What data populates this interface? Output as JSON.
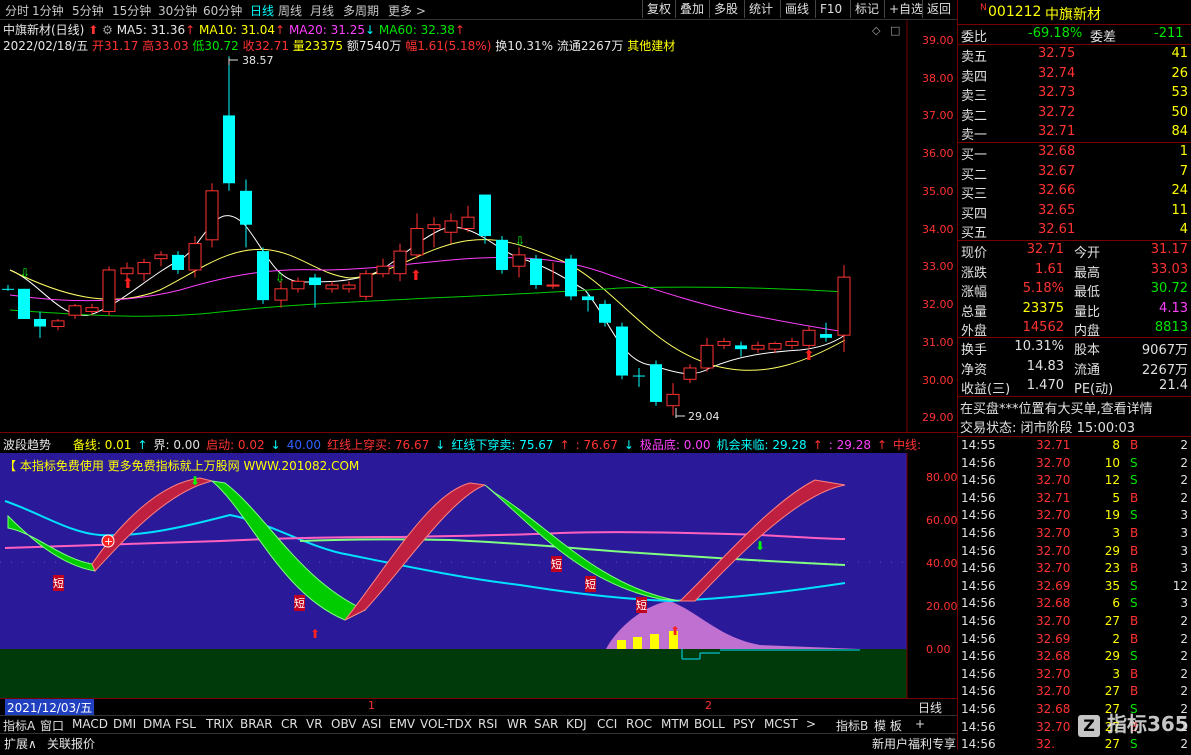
{
  "toolbar": {
    "tabs": [
      "分时",
      "1分钟",
      "5分钟",
      "15分钟",
      "30分钟",
      "60分钟",
      "日线",
      "周线",
      "月线",
      "多周期",
      "更多 >"
    ],
    "buttons": [
      "复权",
      "叠加",
      "多股",
      "统计",
      "画线",
      "F10",
      "标记",
      "+自选",
      "返回"
    ]
  },
  "kline": {
    "stock_label": "中旗新材(日线)",
    "ma5": "MA5: 31.36",
    "ma10": "MA10: 31.04",
    "ma20": "MA20: 31.25",
    "ma60": "MA60: 32.38",
    "info": {
      "date": "2022/02/18/五",
      "open": "开31.17",
      "high": "高33.03",
      "low": "低30.72",
      "close": "收32.71",
      "vol": "量23375",
      "amount": "额7540万",
      "change": "幅1.61(5.18%)",
      "turnover": "换10.31%",
      "float": "流通2267万",
      "industry": "其他建材"
    },
    "high_mark": "38.57",
    "low_mark": "29.04",
    "y_labels": [
      "39.00",
      "38.00",
      "37.00",
      "36.00",
      "35.00",
      "34.00",
      "33.00",
      "32.00",
      "31.00",
      "30.00",
      "29.00"
    ]
  },
  "indicator": {
    "name": "波段趋势",
    "bar_items": [
      {
        "text": "备线: 0.01",
        "cls": "yellow"
      },
      {
        "text": "↑",
        "cls": "cyan"
      },
      {
        "text": "界: 0.00",
        "cls": "white"
      },
      {
        "text": "启动: 0.02",
        "cls": "red"
      },
      {
        "text": "↓",
        "cls": "cyan"
      },
      {
        "text": "40.00",
        "cls": "blue"
      },
      {
        "text": "红线上穿买: 76.67",
        "cls": "red"
      },
      {
        "text": "↓",
        "cls": "cyan"
      },
      {
        "text": "红线下穿卖: 75.67",
        "cls": "cyan"
      },
      {
        "text": "↑",
        "cls": "red"
      },
      {
        "text": ": 76.67",
        "cls": "red"
      },
      {
        "text": "↓",
        "cls": "cyan"
      },
      {
        "text": "极品底: 0.00",
        "cls": "mag"
      },
      {
        "text": "机会来临: 29.28",
        "cls": "cyan"
      },
      {
        "text": "↑",
        "cls": "red"
      },
      {
        "text": ": 29.28",
        "cls": "mag"
      },
      {
        "text": "↑",
        "cls": "red"
      },
      {
        "text": "中线:",
        "cls": "red"
      }
    ],
    "banner": "【 本指标免费使用 更多免费指标就上万股网 WWW.201082.COM",
    "y_labels": [
      "80.00",
      "60.00",
      "40.00",
      "20.00",
      "0.00"
    ],
    "short_label": "短"
  },
  "datebar": {
    "date": "2021/12/03/五",
    "mark1": "1",
    "mark2": "2",
    "period": "日线"
  },
  "tabsbar": {
    "items": [
      "指标A",
      "窗口",
      "MACD",
      "DMI",
      "DMA",
      "FSL",
      "TRIX",
      "BRAR",
      "CR",
      "VR",
      "OBV",
      "ASI",
      "EMV",
      "VOL-TDX",
      "RSI",
      "WR",
      "SAR",
      "KDJ",
      "CCI",
      "ROC",
      "MTM",
      "BOLL",
      "PSY",
      "MCST",
      ">"
    ],
    "right": [
      "指标B",
      "模 板",
      "+"
    ]
  },
  "statusbar": {
    "left1": "扩展∧",
    "left2": "关联报价",
    "right": "新用户福利专享"
  },
  "quote": {
    "code": "001212",
    "name": "中旗新材",
    "wei_bi": "委比",
    "wei_bi_val": "-69.18%",
    "wei_cha": "委差",
    "wei_cha_val": "-211",
    "sells": [
      {
        "label": "卖五",
        "price": "32.75",
        "vol": "41"
      },
      {
        "label": "卖四",
        "price": "32.74",
        "vol": "26"
      },
      {
        "label": "卖三",
        "price": "32.73",
        "vol": "53"
      },
      {
        "label": "卖二",
        "price": "32.72",
        "vol": "50"
      },
      {
        "label": "卖一",
        "price": "32.71",
        "vol": "84"
      }
    ],
    "buys": [
      {
        "label": "买一",
        "price": "32.68",
        "vol": "1"
      },
      {
        "label": "买二",
        "price": "32.67",
        "vol": "7"
      },
      {
        "label": "买三",
        "price": "32.66",
        "vol": "24"
      },
      {
        "label": "买四",
        "price": "32.65",
        "vol": "11"
      },
      {
        "label": "买五",
        "price": "32.61",
        "vol": "4"
      }
    ],
    "stats": [
      {
        "l1": "现价",
        "v1": "32.71",
        "c1": "red",
        "l2": "今开",
        "v2": "31.17",
        "c2": "red"
      },
      {
        "l1": "涨跌",
        "v1": "1.61",
        "c1": "red",
        "l2": "最高",
        "v2": "33.03",
        "c2": "red"
      },
      {
        "l1": "涨幅",
        "v1": "5.18%",
        "c1": "red",
        "l2": "最低",
        "v2": "30.72",
        "c2": "green"
      },
      {
        "l1": "总量",
        "v1": "23375",
        "c1": "yellow",
        "l2": "量比",
        "v2": "4.13",
        "c2": "mag"
      },
      {
        "l1": "外盘",
        "v1": "14562",
        "c1": "red",
        "l2": "内盘",
        "v2": "8813",
        "c2": "green"
      }
    ],
    "stats2": [
      {
        "l1": "换手",
        "v1": "10.31%",
        "c1": "white",
        "l2": "股本",
        "v2": "9067万",
        "c2": "white"
      },
      {
        "l1": "净资",
        "v1": "14.83",
        "c1": "white",
        "l2": "流通",
        "v2": "2267万",
        "c2": "white"
      },
      {
        "l1": "收益(三)",
        "v1": "1.470",
        "c1": "white",
        "l2": "PE(动)",
        "v2": "21.4",
        "c2": "white"
      }
    ],
    "notice": "在买盘***位置有大买单,查看详情",
    "trade_status": "交易状态: 闭市阶段 15:00:03",
    "trades": [
      {
        "t": "14:55",
        "p": "32.71",
        "pc": "red",
        "v": "8",
        "s": "B",
        "n": "2"
      },
      {
        "t": "14:56",
        "p": "32.70",
        "pc": "red",
        "v": "10",
        "s": "S",
        "n": "2"
      },
      {
        "t": "14:56",
        "p": "32.70",
        "pc": "red",
        "v": "12",
        "s": "S",
        "n": "2"
      },
      {
        "t": "14:56",
        "p": "32.71",
        "pc": "red",
        "v": "5",
        "s": "B",
        "n": "2"
      },
      {
        "t": "14:56",
        "p": "32.70",
        "pc": "red",
        "v": "19",
        "s": "S",
        "n": "3"
      },
      {
        "t": "14:56",
        "p": "32.70",
        "pc": "red",
        "v": "3",
        "s": "B",
        "n": "3"
      },
      {
        "t": "14:56",
        "p": "32.70",
        "pc": "red",
        "v": "29",
        "s": "B",
        "n": "3"
      },
      {
        "t": "14:56",
        "p": "32.70",
        "pc": "red",
        "v": "23",
        "s": "B",
        "n": "3"
      },
      {
        "t": "14:56",
        "p": "32.69",
        "pc": "red",
        "v": "35",
        "s": "S",
        "n": "12"
      },
      {
        "t": "14:56",
        "p": "32.68",
        "pc": "red",
        "v": "6",
        "s": "S",
        "n": "3"
      },
      {
        "t": "14:56",
        "p": "32.70",
        "pc": "red",
        "v": "27",
        "s": "B",
        "n": "2"
      },
      {
        "t": "14:56",
        "p": "32.69",
        "pc": "red",
        "v": "2",
        "s": "B",
        "n": "2"
      },
      {
        "t": "14:56",
        "p": "32.68",
        "pc": "red",
        "v": "29",
        "s": "S",
        "n": "2"
      },
      {
        "t": "14:56",
        "p": "32.70",
        "pc": "red",
        "v": "3",
        "s": "B",
        "n": "2"
      },
      {
        "t": "14:56",
        "p": "32.70",
        "pc": "red",
        "v": "27",
        "s": "B",
        "n": "2"
      },
      {
        "t": "14:56",
        "p": "32.68",
        "pc": "red",
        "v": "27",
        "s": "S",
        "n": "2"
      },
      {
        "t": "14:56",
        "p": "32.70",
        "pc": "red",
        "v": "27",
        "s": "B",
        "n": "2"
      },
      {
        "t": "14:56",
        "p": "32.",
        "pc": "red",
        "v": "27",
        "s": "S",
        "n": "2"
      }
    ],
    "watermark": "指标365"
  },
  "colors": {
    "up": "#ff3232",
    "down": "#00ffff",
    "bg": "#000000",
    "grid": "#7a0000",
    "ind_bg": "#2a1a9a",
    "ind_floor": "#003a0a"
  }
}
